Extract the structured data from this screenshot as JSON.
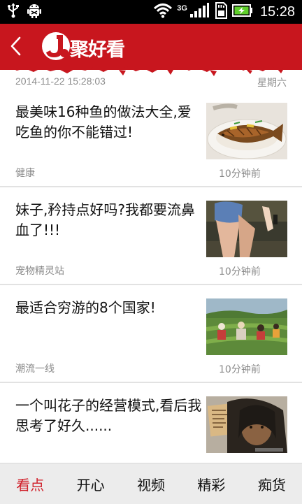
{
  "status_bar": {
    "time": "15:28",
    "network": "3G",
    "icons": [
      "usb-icon",
      "android-debug-icon",
      "wifi-icon",
      "signal-icon",
      "sd-card-icon",
      "battery-charging-icon"
    ]
  },
  "header": {
    "logo_letter": "J",
    "logo_text": "聚好看",
    "accent_color": "#c8161e"
  },
  "date_row": {
    "date": "2014-11-22 15:28:03",
    "weekday": "星期六"
  },
  "news": [
    {
      "title": "最美味16种鱼的做法大全,爱吃鱼的你不能错过!",
      "source": "健康",
      "time": "10分钟前",
      "thumb": "fish-dish"
    },
    {
      "title": "妹子,矜持点好吗?我都要流鼻血了!!!",
      "source": "宠物精灵站",
      "time": "10分钟前",
      "thumb": "legs-photo"
    },
    {
      "title": "最适合穷游的8个国家!",
      "source": "潮流一线",
      "time": "10分钟前",
      "thumb": "tea-pickers"
    },
    {
      "title": "一个叫花子的经营模式,看后我思考了好久......",
      "source": "",
      "time": "",
      "thumb": "beggar-photo"
    }
  ],
  "tabs": [
    {
      "label": "看点",
      "active": true
    },
    {
      "label": "开心",
      "active": false
    },
    {
      "label": "视频",
      "active": false
    },
    {
      "label": "精彩",
      "active": false
    },
    {
      "label": "痴货",
      "active": false
    }
  ]
}
